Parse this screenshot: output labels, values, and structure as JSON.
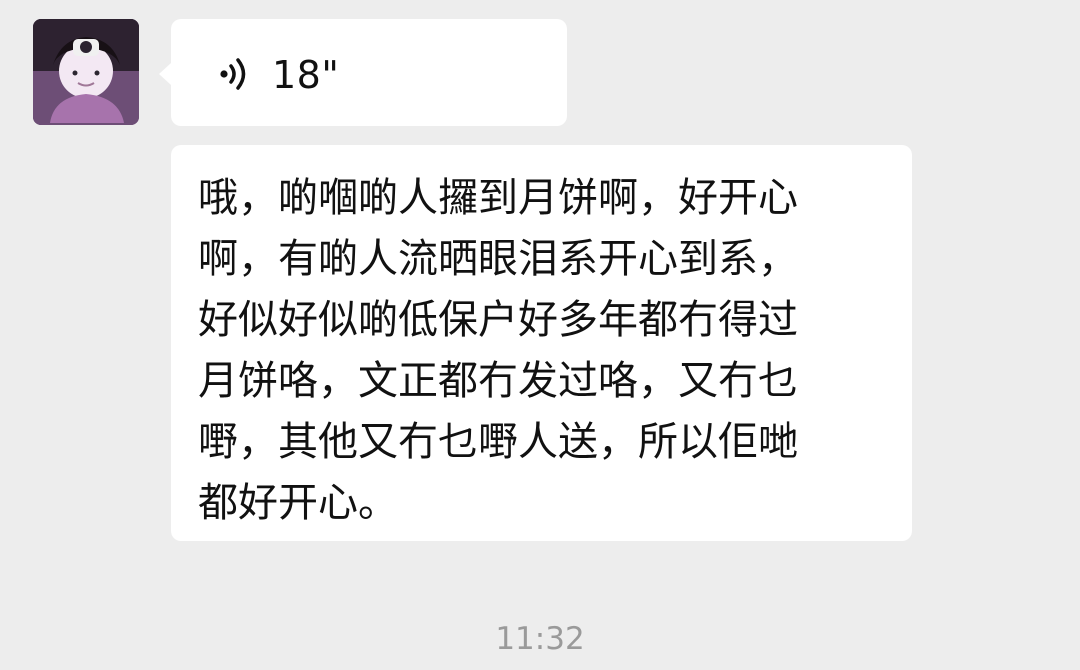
{
  "chat": {
    "messages": [
      {
        "type": "voice",
        "icon": "voice-wave-icon",
        "duration": "18\""
      },
      {
        "type": "text",
        "text": "哦，啲嗰啲人攞到月饼啊，好开心\n啊，有啲人流晒眼泪系开心到系，\n好似好似啲低保户好多年都冇得过\n月饼咯，文正都冇发过咯，又冇乜\n嘢，其他又冇乜嘢人送，所以佢哋\n都好开心。"
      }
    ],
    "timestamp": "11:32"
  },
  "colors": {
    "background": "#ededed",
    "bubble": "#ffffff",
    "text": "#111111",
    "timestamp": "#9a9a9a"
  }
}
